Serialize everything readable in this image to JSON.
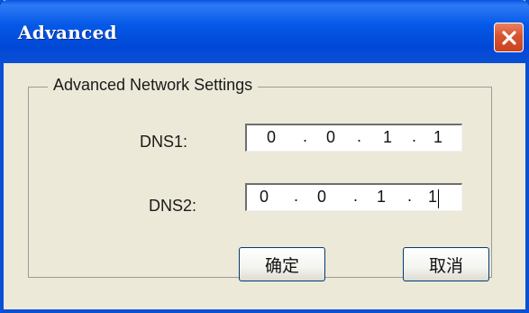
{
  "window": {
    "title": "Advanced",
    "close_icon": "close-icon",
    "colors": {
      "titlebar": "#0458e6",
      "face": "#ece9d8",
      "close": "#d9532f"
    }
  },
  "group": {
    "legend": "Advanced Network Settings"
  },
  "dns1": {
    "label": "DNS1:",
    "octets": [
      "0",
      "0",
      "1",
      "1"
    ],
    "separator": "."
  },
  "dns2": {
    "label": "DNS2:",
    "octets": [
      "0",
      "0",
      "1",
      "1"
    ],
    "separator": "."
  },
  "buttons": {
    "ok": "确定",
    "cancel": "取消"
  }
}
